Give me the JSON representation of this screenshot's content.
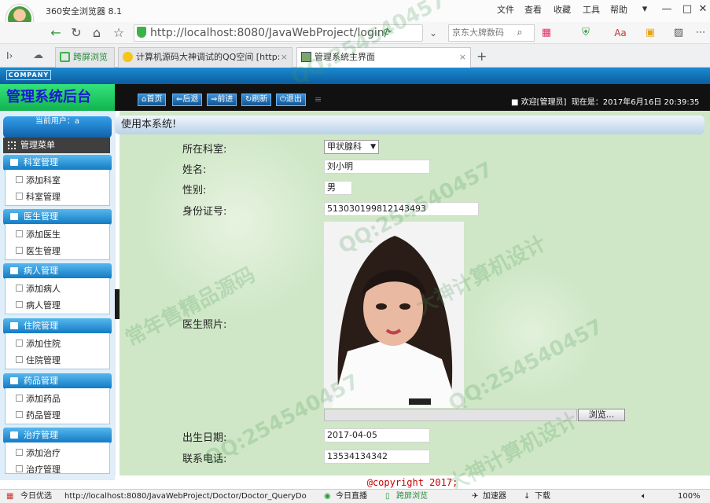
{
  "browser": {
    "app_title": "360安全浏览器 8.1",
    "menu": [
      "文件",
      "查看",
      "收藏",
      "工具",
      "帮助"
    ],
    "url": "http://localhost:8080/JavaWebProject/login/",
    "search_text": "京东大牌数码",
    "tabs": [
      {
        "label": "跨屏浏览",
        "active": false
      },
      {
        "label": "计算机源码大神调试的QQ空间 [http:",
        "active": false
      },
      {
        "label": "管理系统主界面",
        "active": true
      }
    ]
  },
  "header": {
    "company": "COMPANY",
    "system_title": "管理系统后台",
    "toolbar": [
      "首页",
      "后退",
      "前进",
      "刷新",
      "退出"
    ],
    "welcome": "■ 欢迎[管理员]",
    "date_text": "现在是：2017年6月16日 20:39:35"
  },
  "sidebar": {
    "current_user": "当前用户：a",
    "menu_title": "管理菜单",
    "groups": [
      {
        "title": "科室管理",
        "items": [
          "添加科室",
          "科室管理"
        ]
      },
      {
        "title": "医生管理",
        "items": [
          "添加医生",
          "医生管理"
        ]
      },
      {
        "title": "病人管理",
        "items": [
          "添加病人",
          "病人管理"
        ]
      },
      {
        "title": "住院管理",
        "items": [
          "添加住院",
          "住院管理"
        ]
      },
      {
        "title": "药品管理",
        "items": [
          "添加药品",
          "药品管理"
        ]
      },
      {
        "title": "治疗管理",
        "items": [
          "添加治疗",
          "治疗管理"
        ]
      }
    ]
  },
  "main": {
    "banner": "使用本系统!",
    "form": {
      "department_label": "所在科室:",
      "department_value": "甲状腺科",
      "name_label": "姓名:",
      "name_value": "刘小明",
      "gender_label": "性别:",
      "gender_value": "男",
      "idcard_label": "身份证号:",
      "idcard_value": "513030199812143493",
      "photo_label": "医生照片:",
      "browse_label": "浏览...",
      "birth_label": "出生日期:",
      "birth_value": "2017-04-05",
      "phone_label": "联系电话:",
      "phone_value": "13534134342"
    },
    "footer": "@copyright 2017;"
  },
  "statusbar": {
    "left": "今日优选",
    "url": "http://localhost:8080/JavaWebProject/Doctor/Doctor_QueryDo",
    "items": [
      "今日直播",
      "跨屏浏览",
      "加速器",
      "下载"
    ],
    "zoom": "100%"
  },
  "watermark": {
    "qq": "QQ:254540457",
    "slogan": "常年售精品源码",
    "slogan2": "大神计算机设计"
  }
}
